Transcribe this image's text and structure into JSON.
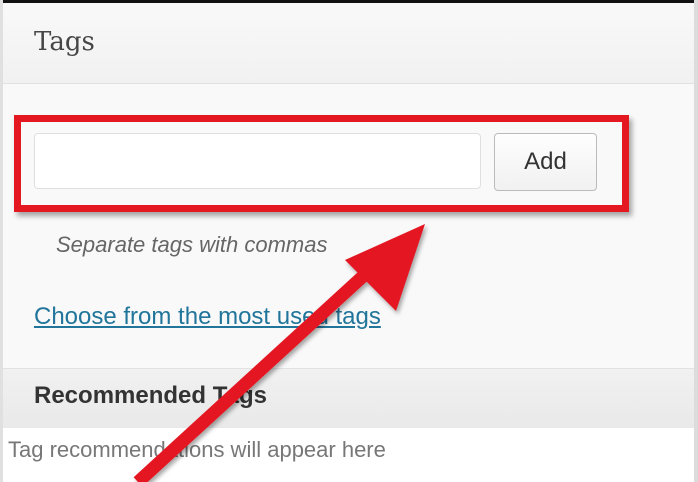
{
  "tags_panel": {
    "title": "Tags",
    "input": {
      "value": "",
      "placeholder": ""
    },
    "add_label": "Add",
    "hint": "Separate tags with commas",
    "most_used_link": "Choose from the most used tags"
  },
  "recommended": {
    "title": "Recommended Tags",
    "placeholder": "Tag recommendations will appear here"
  },
  "annotation": {
    "highlight_color": "#e41820",
    "arrow_color": "#e41820"
  }
}
